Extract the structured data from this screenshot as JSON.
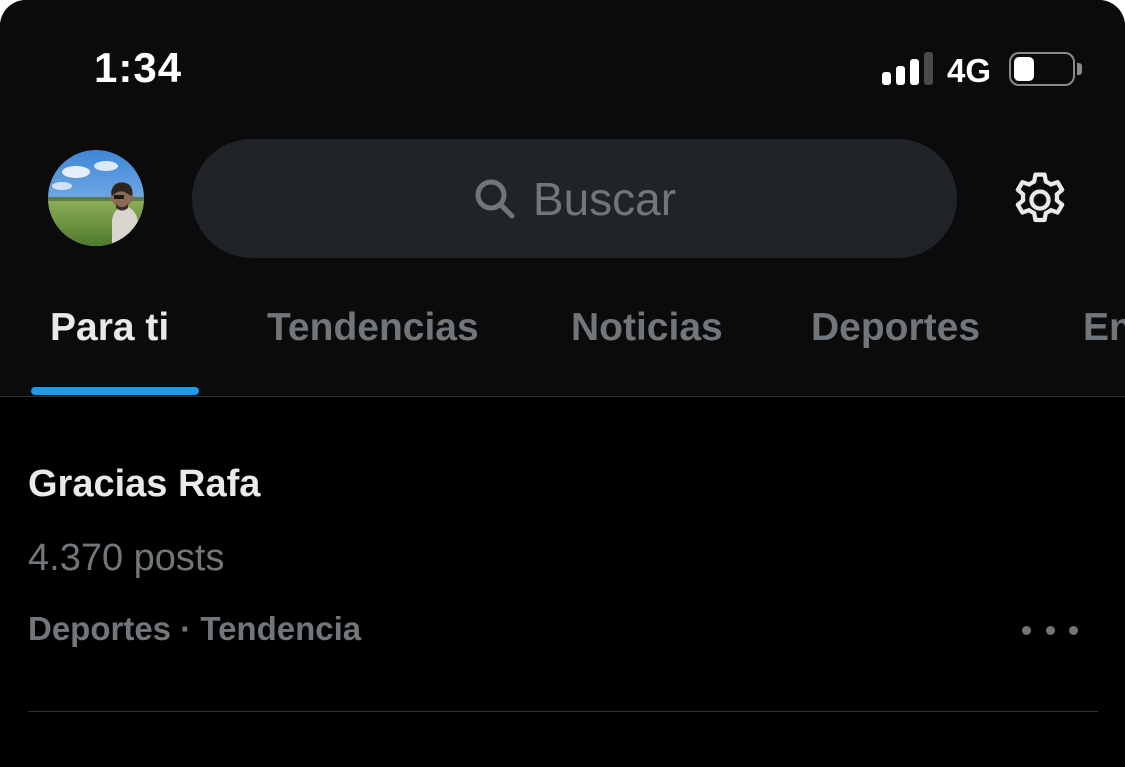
{
  "status_bar": {
    "time": "1:34",
    "network": "4G",
    "signal_bars_active": 3,
    "signal_bars_total": 4,
    "battery_level": 0.35
  },
  "header": {
    "avatar_icon": "profile-avatar",
    "search": {
      "placeholder": "Buscar",
      "icon": "search-icon"
    },
    "settings_icon": "gear-icon"
  },
  "tabs": [
    {
      "label": "Para ti",
      "active": true
    },
    {
      "label": "Tendencias",
      "active": false
    },
    {
      "label": "Noticias",
      "active": false
    },
    {
      "label": "Deportes",
      "active": false
    },
    {
      "label": "En",
      "active": false
    }
  ],
  "trends": [
    {
      "title": "Gracias Rafa",
      "count": "4.370 posts",
      "category": "Deportes · Tendencia"
    }
  ],
  "colors": {
    "background": "#000000",
    "header_background": "#0b0b0c",
    "search_background": "#202327",
    "accent": "#1d9bf0",
    "text_primary": "#e7e9ea",
    "text_secondary": "#71767b",
    "divider": "#2f3336"
  }
}
